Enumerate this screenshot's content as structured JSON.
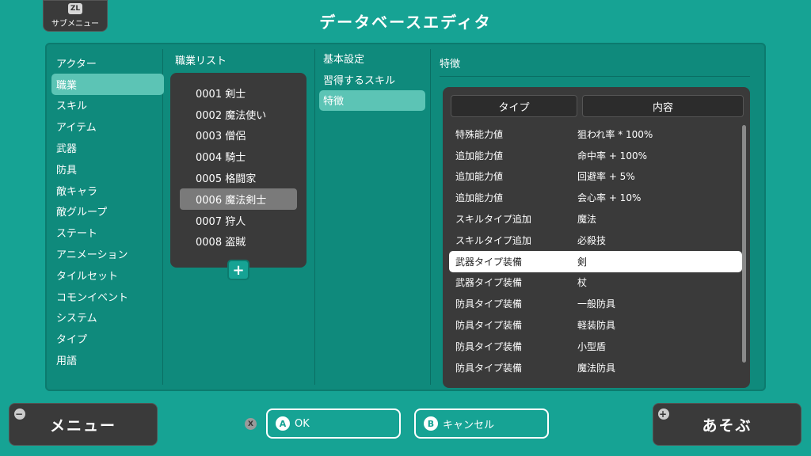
{
  "header": {
    "submenu_key": "ZL",
    "submenu_label": "サブメニュー",
    "title": "データベースエディタ"
  },
  "categories": [
    {
      "label": "アクター",
      "selected": false
    },
    {
      "label": "職業",
      "selected": true
    },
    {
      "label": "スキル",
      "selected": false
    },
    {
      "label": "アイテム",
      "selected": false
    },
    {
      "label": "武器",
      "selected": false
    },
    {
      "label": "防具",
      "selected": false
    },
    {
      "label": "敵キャラ",
      "selected": false
    },
    {
      "label": "敵グループ",
      "selected": false
    },
    {
      "label": "ステート",
      "selected": false
    },
    {
      "label": "アニメーション",
      "selected": false
    },
    {
      "label": "タイルセット",
      "selected": false
    },
    {
      "label": "コモンイベント",
      "selected": false
    },
    {
      "label": "システム",
      "selected": false
    },
    {
      "label": "タイプ",
      "selected": false
    },
    {
      "label": "用語",
      "selected": false
    }
  ],
  "class_list": {
    "heading": "職業リスト",
    "add_symbol": "+",
    "items": [
      {
        "label": "0001 剣士",
        "selected": false
      },
      {
        "label": "0002 魔法使い",
        "selected": false
      },
      {
        "label": "0003 僧侶",
        "selected": false
      },
      {
        "label": "0004 騎士",
        "selected": false
      },
      {
        "label": "0005 格闘家",
        "selected": false
      },
      {
        "label": "0006 魔法剣士",
        "selected": true
      },
      {
        "label": "0007 狩人",
        "selected": false
      },
      {
        "label": "0008 盗賊",
        "selected": false
      }
    ]
  },
  "tabs": [
    {
      "label": "基本設定",
      "selected": false
    },
    {
      "label": "習得するスキル",
      "selected": false
    },
    {
      "label": "特徴",
      "selected": true
    }
  ],
  "traits": {
    "title": "特徴",
    "col_type": "タイプ",
    "col_content": "内容",
    "rows": [
      {
        "type": "特殊能力値",
        "content": "狙われ率 * 100%",
        "selected": false
      },
      {
        "type": "追加能力値",
        "content": "命中率 + 100%",
        "selected": false
      },
      {
        "type": "追加能力値",
        "content": "回避率 + 5%",
        "selected": false
      },
      {
        "type": "追加能力値",
        "content": "会心率 + 10%",
        "selected": false
      },
      {
        "type": "スキルタイプ追加",
        "content": "魔法",
        "selected": false
      },
      {
        "type": "スキルタイプ追加",
        "content": "必殺技",
        "selected": false
      },
      {
        "type": "武器タイプ装備",
        "content": "剣",
        "selected": true
      },
      {
        "type": "武器タイプ装備",
        "content": "杖",
        "selected": false
      },
      {
        "type": "防具タイプ装備",
        "content": "一般防具",
        "selected": false
      },
      {
        "type": "防具タイプ装備",
        "content": "軽装防具",
        "selected": false
      },
      {
        "type": "防具タイプ装備",
        "content": "小型盾",
        "selected": false
      },
      {
        "type": "防具タイプ装備",
        "content": "魔法防具",
        "selected": false
      }
    ]
  },
  "footer": {
    "menu_key": "−",
    "menu_label": "メニュー",
    "x_key": "X",
    "ok_key": "A",
    "ok_label": "OK",
    "cancel_key": "B",
    "cancel_label": "キャンセル",
    "play_key": "+",
    "play_label": "あそぶ"
  },
  "colors": {
    "background": "#16a394",
    "panel": "#0f8a7c",
    "selection": "#5cc4b5",
    "dark_panel": "#3a3a3a"
  }
}
